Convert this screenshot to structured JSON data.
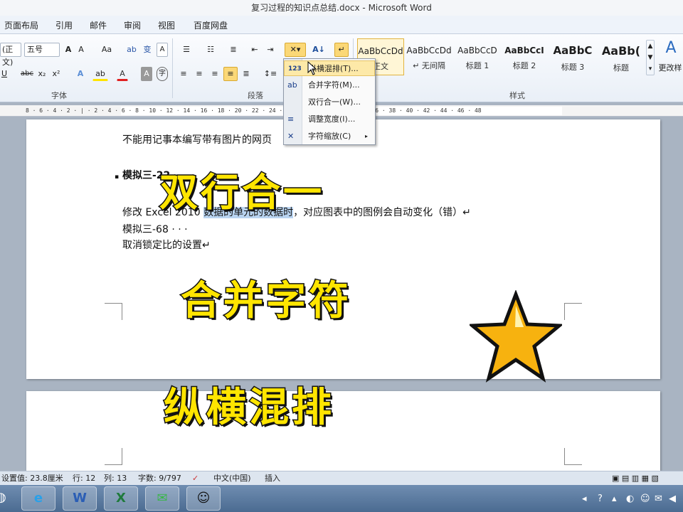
{
  "window": {
    "title": "复习过程的知识点总结.docx - Microsoft Word"
  },
  "tabs": [
    "页面布局",
    "引用",
    "邮件",
    "审阅",
    "视图",
    "百度网盘"
  ],
  "ribbon": {
    "font": {
      "font_name": "(正文)",
      "font_size": "五号",
      "group_label": "字体"
    },
    "paragraph": {
      "group_label": "段落"
    },
    "styles": {
      "group_label": "样式",
      "items": [
        {
          "sample": "AaBbCcDd",
          "name": "正文",
          "selected": true
        },
        {
          "sample": "AaBbCcDd",
          "name": "↵ 无间隔"
        },
        {
          "sample": "AaBbCcD",
          "name": "标题 1"
        },
        {
          "sample": "AaBbCcI",
          "name": "标题 2"
        },
        {
          "sample": "AaBbC",
          "name": "标题 3"
        },
        {
          "sample": "AaBb(",
          "name": "标题"
        }
      ],
      "change_styles_label": "更改样"
    }
  },
  "menu": {
    "items": [
      {
        "label": "纵横混排(T)...",
        "icon": "vertical-horizontal-icon",
        "glyph": "123"
      },
      {
        "label": "合并字符(M)...",
        "icon": "combine-characters-icon",
        "glyph": "ab"
      },
      {
        "label": "双行合一(W)...",
        "icon": "two-lines-in-one-icon",
        "glyph": ""
      },
      {
        "label": "调整宽度(I)...",
        "icon": "adjust-width-icon",
        "glyph": "≡"
      },
      {
        "label": "字符缩放(C)",
        "icon": "character-scale-icon",
        "glyph": "✕"
      }
    ]
  },
  "ruler": {
    "text": "8 · 6 · 4 · 2 · | · 2 · 4 · 6 · 8 · 10 · 12 · 14 · 16 · 18 · 20 · 22 · 24 · 26 · 28 · 30 · 32 · 34 · 36 · 38 · 40 · 42 · 44 · 46 · 48"
  },
  "document": {
    "line1": "不能用记事本编写带有图片的网页",
    "heading": "模拟三-22",
    "line3_before": "修改 Excel 2010 ",
    "line3_highlight": "数据的单元的数据时",
    "line3_after": "，对应图表中的图例会自动变化（错）↵",
    "line4": "模拟三-68 · · ·",
    "line5": "取消锁定比的设置↵"
  },
  "captions": [
    "双行合一",
    "合并字符",
    "纵横混排"
  ],
  "status": {
    "position": "设置值: 23.8厘米",
    "row": "行: 12",
    "col": "列: 13",
    "words": "字数: 9/797",
    "language": "中文(中国)",
    "insert": "插入"
  },
  "taskbar": {
    "apps": [
      {
        "name": "ie",
        "glyph": "e",
        "color": "#2aa0e8"
      },
      {
        "name": "word",
        "glyph": "W",
        "color": "#2b5eb5"
      },
      {
        "name": "excel",
        "glyph": "X",
        "color": "#1f7a3c"
      },
      {
        "name": "wechat",
        "glyph": "✉",
        "color": "#3ab54a"
      },
      {
        "name": "qq",
        "glyph": "☺",
        "color": "#111"
      }
    ]
  },
  "colors": {
    "caption_fill": "#ffe500",
    "star_fill": "#f7b20f",
    "menu_hover": "#fde9a8"
  }
}
